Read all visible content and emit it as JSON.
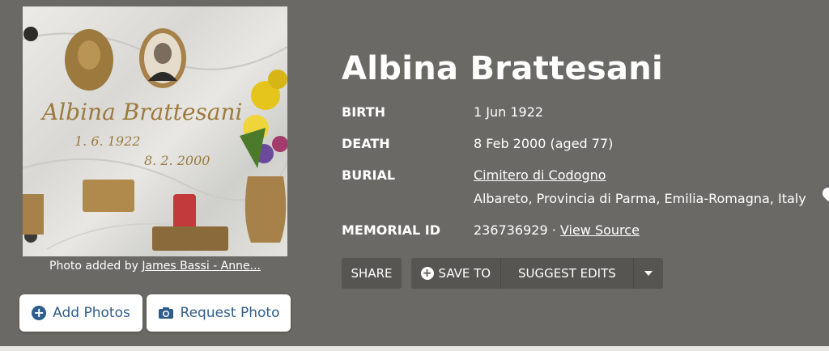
{
  "memorial": {
    "name": "Albina Brattesani",
    "birth_label": "BIRTH",
    "birth_value": "1 Jun 1922",
    "death_label": "DEATH",
    "death_value": "8 Feb 2000 (aged 77)",
    "burial_label": "BURIAL",
    "burial_cemetery": "Cimitero di Codogno",
    "burial_location": "Albareto, Provincia di Parma, Emilia-Romagna, Italy",
    "memorial_id_label": "MEMORIAL ID",
    "memorial_id_value": "236736929",
    "separator": "·",
    "view_source": "View Source"
  },
  "photo": {
    "caption_prefix": "Photo added by",
    "caption_author": "James Bassi - Anne...",
    "plaque_name": "Albina Brattesani",
    "plaque_birth": "1. 6. 1922",
    "plaque_death": "8. 2. 2000"
  },
  "buttons": {
    "add_photos": "Add Photos",
    "request_photo": "Request Photo",
    "share": "SHARE",
    "save_to": "SAVE TO",
    "suggest_edits": "SUGGEST EDITS"
  },
  "icons": {
    "add": "plus-circle-icon",
    "camera": "camera-icon",
    "caret": "caret-down-icon",
    "location": "map-pin-icon"
  }
}
